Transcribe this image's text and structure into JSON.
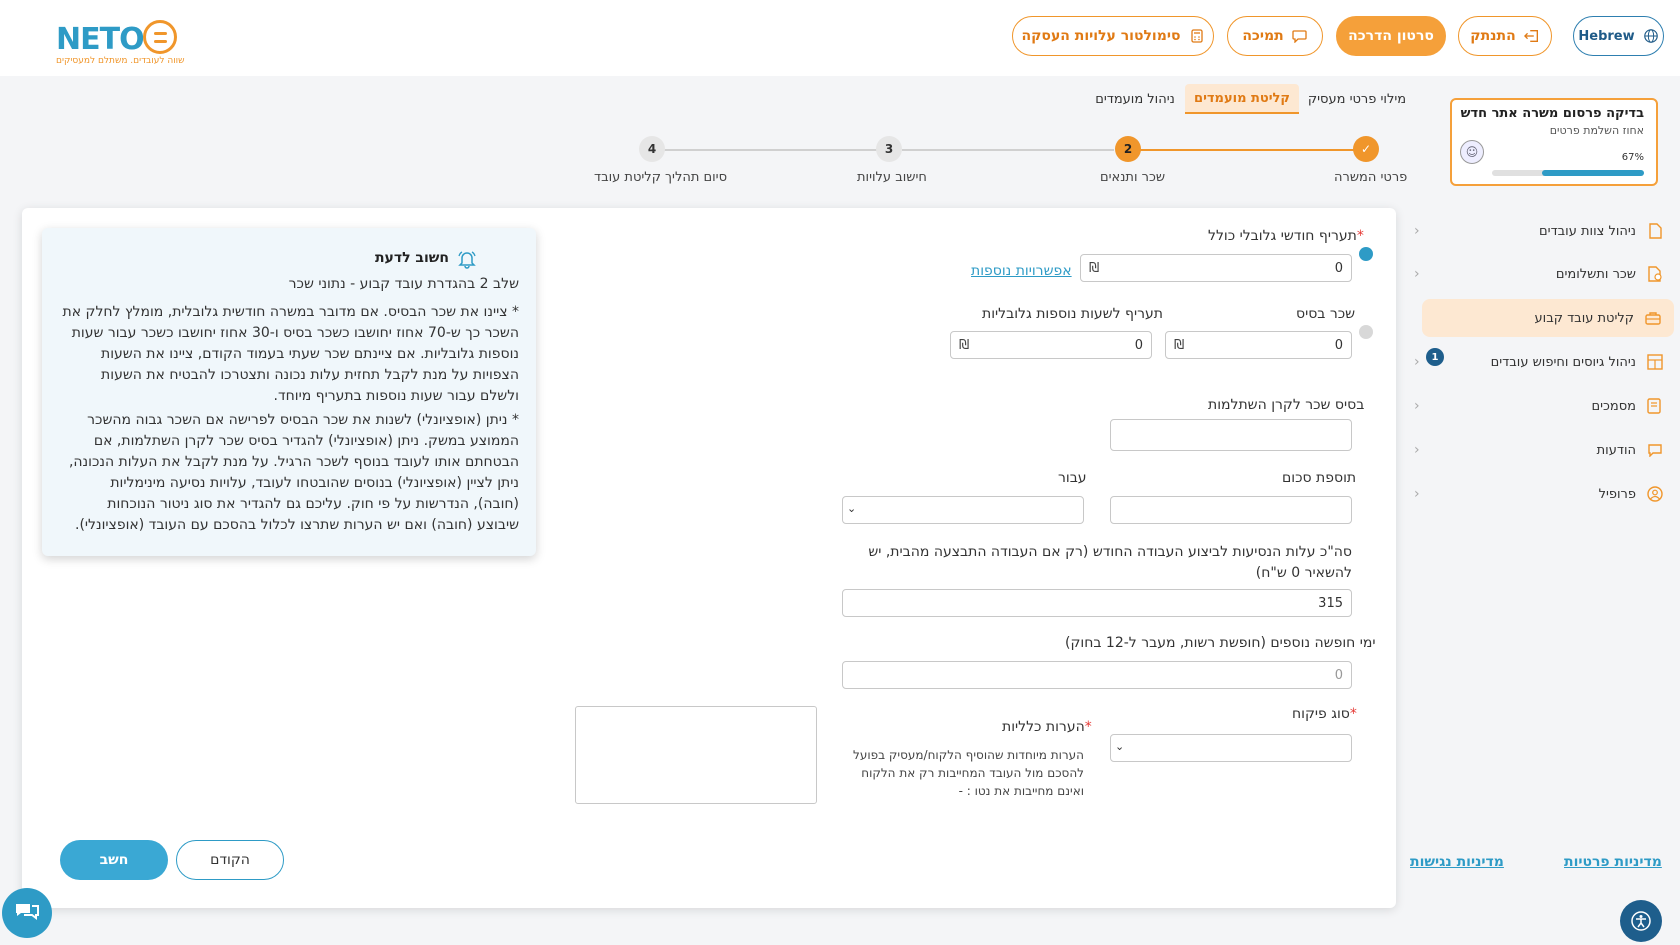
{
  "header": {
    "logo_word": "NETO",
    "logo_tagline": "שווה לעובדים. משתלם למעסיקים",
    "buttons": {
      "simulator": "סימולטור עלויות העסקה",
      "support": "תמיכה",
      "tutorial": "סרטון הדרכה",
      "logout": "התנתק",
      "language": "Hebrew"
    }
  },
  "tabs": [
    "מילוי פרטי מעסיק",
    "קליטת מועמדים",
    "ניהול מועמדים"
  ],
  "progress_card": {
    "title": "בדיקה פרסום משרה אתר חדש",
    "subtitle": "אחוז השלמת פרטים",
    "percent_label": "67%",
    "percent": 67
  },
  "stepper": {
    "steps": [
      {
        "num": "✓",
        "label": "פרטי המשרה",
        "state": "done"
      },
      {
        "num": "2",
        "label": "שכר ותנאים",
        "state": "current"
      },
      {
        "num": "3",
        "label": "חישוב עלויות",
        "state": "todo"
      },
      {
        "num": "4",
        "label": "סיום תהליך קליטת עובד",
        "state": "todo"
      }
    ]
  },
  "sidebar": {
    "items": [
      {
        "label": "ניהול צוות עובדים",
        "icon": "file-icon"
      },
      {
        "label": "שכר ותשלומים",
        "icon": "payment-icon"
      },
      {
        "label": "קליטת עובד קבוע",
        "icon": "briefcase-icon"
      },
      {
        "label": "ניהול גיוסים וחיפוש עובדים",
        "icon": "grid-icon",
        "badge": "1"
      },
      {
        "label": "מסמכים",
        "icon": "documents-icon"
      },
      {
        "label": "הודעות",
        "icon": "chat-icon"
      },
      {
        "label": "פרופיל",
        "icon": "user-icon"
      }
    ],
    "policy_privacy": "מדיניות פרטיות",
    "policy_accessibility": "מדיניות נגישות"
  },
  "form": {
    "global_salary_label": "תעריף חודשי גלובלי כולל",
    "global_salary_value": "0",
    "more_options_link": "אפשרויות נוספות",
    "base_salary_label": "שכר בסיס",
    "base_salary_value": "0",
    "overtime_rate_label": "תעריף לשעות נוספות גלובליות",
    "overtime_rate_value": "0",
    "pension_base_label": "בסיס שכר לקרן השתלמות",
    "pension_base_value": "",
    "bonus_label": "תוספת סכום",
    "bonus_value": "",
    "for_label": "עבור",
    "travel_label": "סה\"כ עלות הנסיעות לביצוע העבודה החודש (רק אם העבודה התבצעה מהבית, יש להשאיר 0 ש\"ח)",
    "travel_value": "315",
    "vacation_label": "ימי חופשה נוספים (חופשת רשות, מעבר ל-12 בחוק)",
    "vacation_placeholder": "0",
    "supervision_label": "סוג פיקוח",
    "notes_label": "הערות כלליות",
    "notes_hint": "הערות מיוחדות שהוסיף הלקוח/מעסיק בפועל להסכם מול העובד המחייבות רק את הלקוח ואינם מחייבות את נטו : -",
    "prev_button": "הקודם",
    "calc_button": "חשב",
    "currency": "₪"
  },
  "info_box": {
    "title": "חשוב לדעת",
    "subtitle": "שלב 2 בהגדרת עובד קבוע - נתוני שכר",
    "para1": "* ציינו את שכר הבסיס. אם מדובר במשרה חודשית גלובלית, מומלץ לחלק את השכר כך ש-70 אחוז יחושבו כשכר בסיס ו-30 אחוז יחושבו כשכר עבור שעות נוספות גלובליות. אם ציינתם שכר שעתי בעמוד הקודם, ציינו את השעות הצפויות על מנת לקבל תחזית עלות נכונה ותצטרכו להבטיח את השעות ולשלם עבור שעות נוספות בתעריף מיוחד.",
    "para2": "* ניתן (אופציונלי) לשנות את שכר הבסיס לפרישה אם השכר גבוה מהשכר הממוצע במשק. ניתן (אופציונלי) להגדיר בסיס שכר לקרן השתלמות, אם הבטחתם אותו לעובד בנוסף לשכר הרגיל. על מנת לקבל את העלות הנכונה, ניתן לציין (אופציונלי) בנוסים שהובטחו לעובד, עלויות נסיעה מינימליות (חובה), הנדרשות על פי חוק. עליכם גם להגדיר את סוג ניטור הנוכחות שיבוצע (חובה) ואם יש הערות שתרצו לכלול בהסכם עם העובד (אופציונלי)."
  },
  "colors": {
    "accent_orange": "#f0962b",
    "accent_blue": "#2e9bc6",
    "dark_blue": "#1e5e8c"
  }
}
